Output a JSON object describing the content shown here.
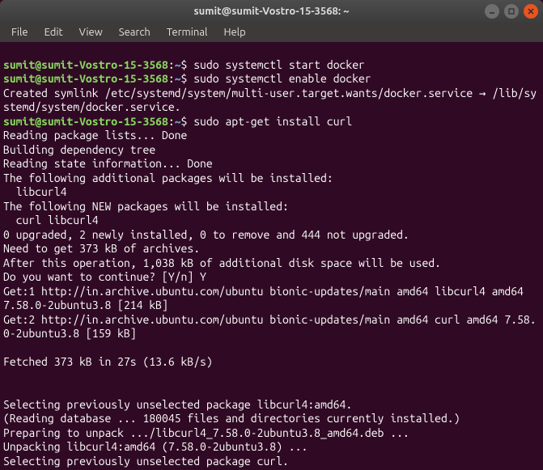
{
  "window": {
    "title": "sumit@sumit-Vostro-15-3568: ~"
  },
  "menu": {
    "file": "File",
    "edit": "Edit",
    "view": "View",
    "search": "Search",
    "terminal": "Terminal",
    "help": "Help"
  },
  "prompt": {
    "user_host": "sumit@sumit-Vostro-15-3568",
    "sep": ":",
    "path": "~",
    "symbol": "$"
  },
  "commands": {
    "cmd1": "sudo systemctl start docker",
    "cmd2": "sudo systemctl enable docker",
    "cmd3": "sudo apt-get install curl"
  },
  "output": {
    "enable_out": "Created symlink /etc/systemd/system/multi-user.target.wants/docker.service → /lib/systemd/system/docker.service.",
    "reading_lists": "Reading package lists... Done",
    "building_tree": "Building dependency tree",
    "reading_state": "Reading state information... Done",
    "additional_hdr": "The following additional packages will be installed:",
    "additional_pkgs": "  libcurl4",
    "new_hdr": "The following NEW packages will be installed:",
    "new_pkgs": "  curl libcurl4",
    "upgrade_summary": "0 upgraded, 2 newly installed, 0 to remove and 444 not upgraded.",
    "need_get": "Need to get 373 kB of archives.",
    "disk_space": "After this operation, 1,038 kB of additional disk space will be used.",
    "continue_prompt": "Do you want to continue? [Y/n] Y",
    "get1": "Get:1 http://in.archive.ubuntu.com/ubuntu bionic-updates/main amd64 libcurl4 amd64 7.58.0-2ubuntu3.8 [214 kB]",
    "get2": "Get:2 http://in.archive.ubuntu.com/ubuntu bionic-updates/main amd64 curl amd64 7.58.0-2ubuntu3.8 [159 kB]",
    "blank": "",
    "fetched": "Fetched 373 kB in 27s (13.6 kB/s)",
    "select1": "Selecting previously unselected package libcurl4:amd64.",
    "reading_db": "(Reading database ... 180045 files and directories currently installed.)",
    "preparing1": "Preparing to unpack .../libcurl4_7.58.0-2ubuntu3.8_amd64.deb ...",
    "unpacking1": "Unpacking libcurl4:amd64 (7.58.0-2ubuntu3.8) ...",
    "select2": "Selecting previously unselected package curl."
  }
}
